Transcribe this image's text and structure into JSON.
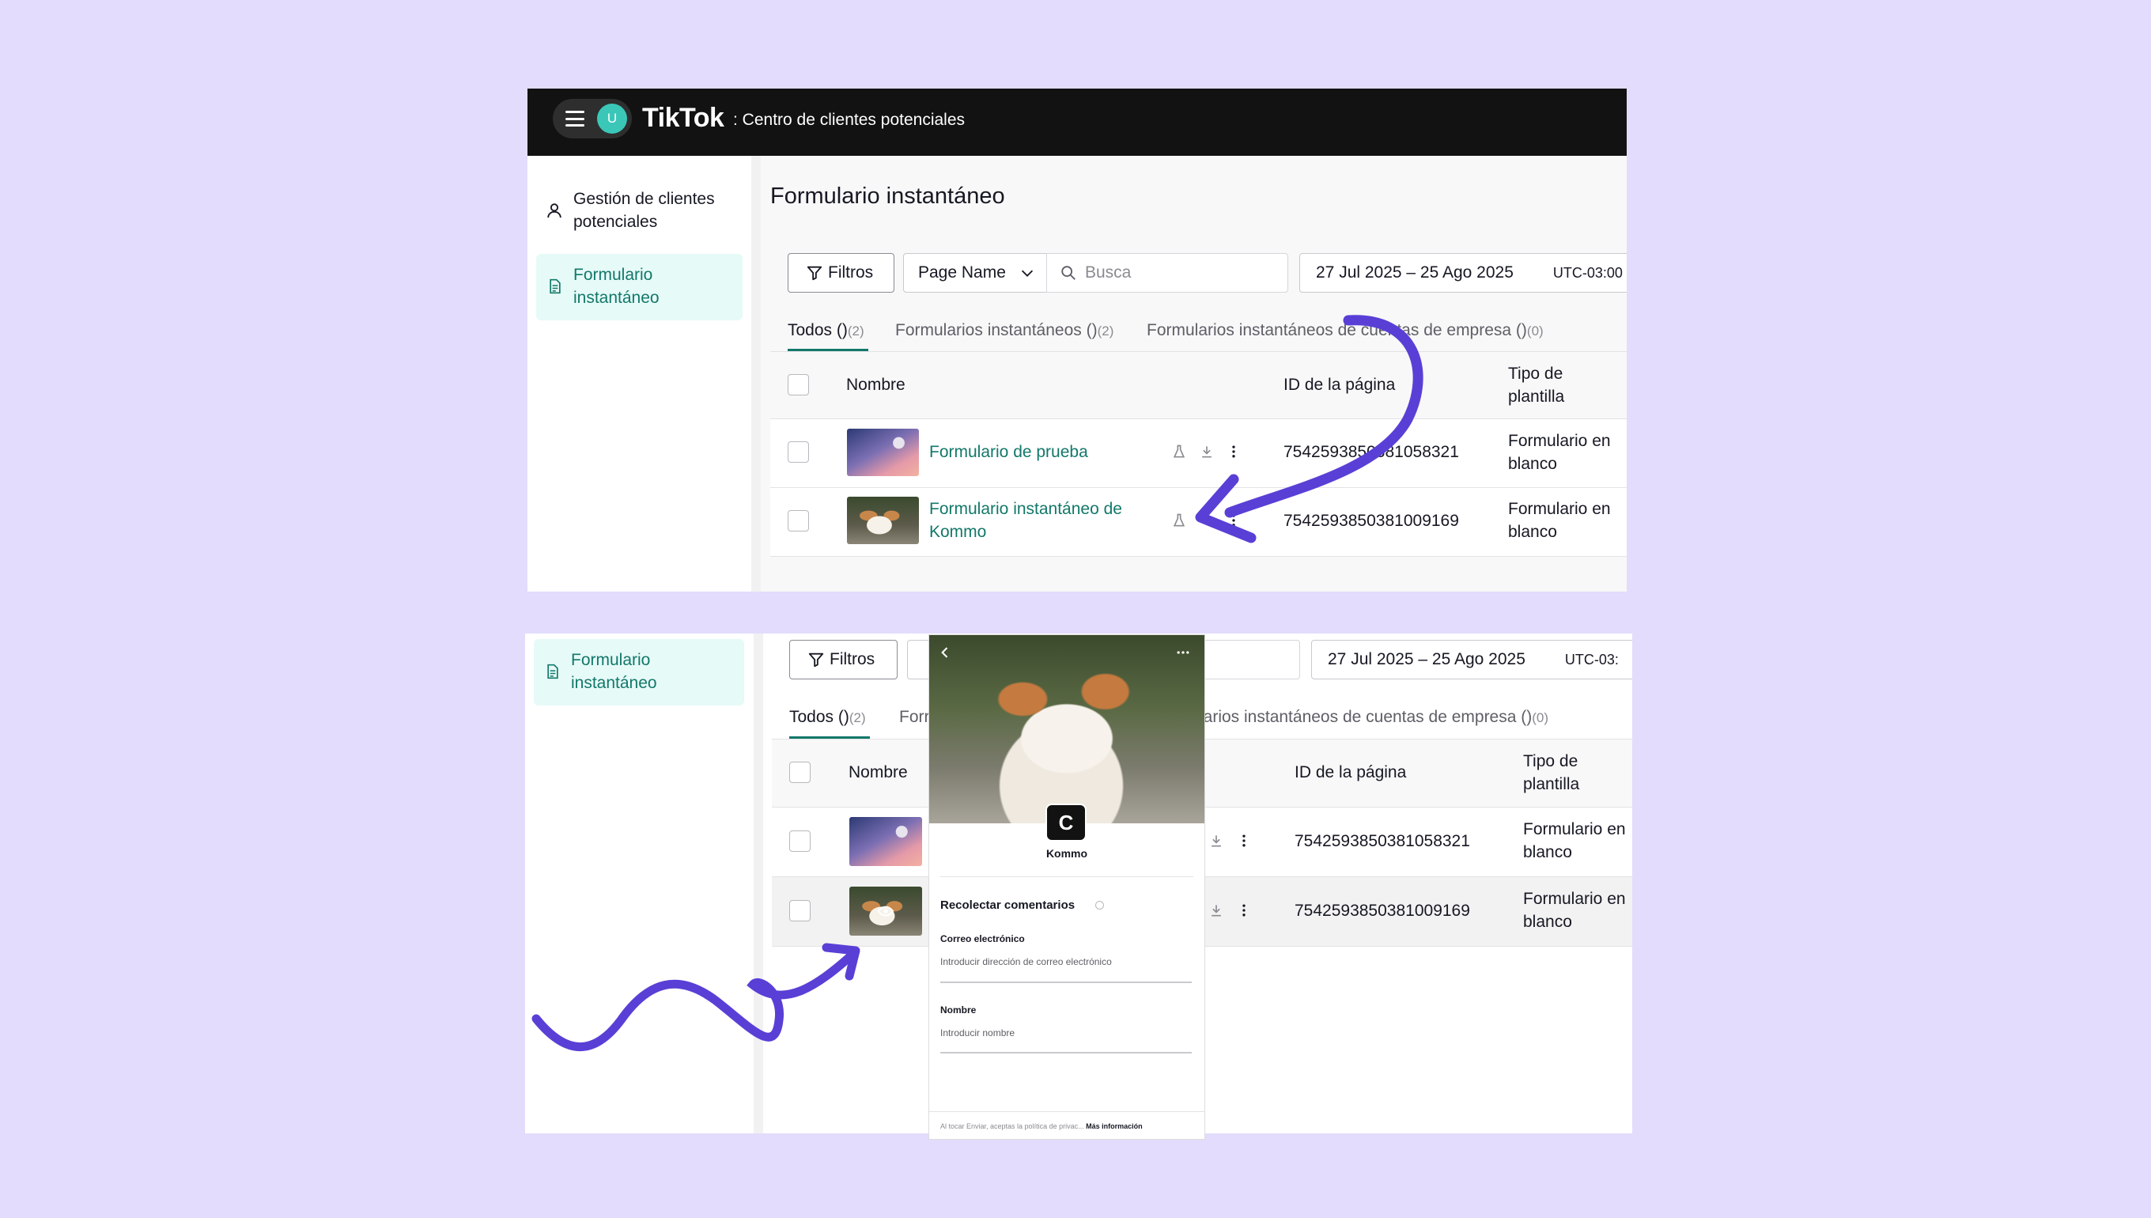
{
  "colors": {
    "background": "#e3dcfc",
    "accent": "#127869",
    "arrow": "#5a3fd6",
    "topbar": "#121212",
    "avatar": "#3bc7b8"
  },
  "header": {
    "avatar_initial": "U",
    "brand": "TikTok",
    "subtitle": ": Centro de clientes potenciales",
    "menu_icon": "hamburger-icon"
  },
  "sidebar": {
    "item_leads": "Gestión de clientes potenciales",
    "item_forms": "Formulario instantáneo",
    "icon_leads": "user-icon",
    "icon_forms": "document-icon"
  },
  "page": {
    "title": "Formulario instantáneo"
  },
  "toolbar": {
    "filters": "Filtros",
    "page_name": "Page Name",
    "search_placeholder": "Busca",
    "date_range": "27 Jul 2025 – 25 Ago 2025",
    "timezone_top": "UTC-03:00",
    "timezone_bottom": "UTC-03:"
  },
  "tabs": [
    {
      "label": "Todos ()",
      "count": "(2)"
    },
    {
      "label": "Formularios instantáneos ()",
      "count": "(2)"
    },
    {
      "label": "Formularios instantáneos de cuentas de empresa ()",
      "count": "(0)"
    }
  ],
  "tabs_bottom": {
    "partial_second": "Forr",
    "partial_third": "larios instantáneos de cuentas de empresa ()"
  },
  "table": {
    "headers": {
      "name": "Nombre",
      "page_id": "ID de la página",
      "template_line1": "Tipo de",
      "template_line2": "plantilla"
    },
    "rows": [
      {
        "name": "Formulario de prueba",
        "page_id": "7542593850381058321",
        "template_line1": "Formulario en",
        "template_line2": "blanco"
      },
      {
        "name_line1": "Formulario instantáneo de",
        "name_line2": "Kommo",
        "page_id": "7542593850381009169",
        "template_line1": "Formulario en",
        "template_line2": "blanco"
      }
    ]
  },
  "preview": {
    "brand": "Kommo",
    "logo_letter": "C",
    "section_title": "Recolectar comentarios",
    "email_label": "Correo electrónico",
    "email_placeholder": "Introducir dirección de correo electrónico",
    "name_label": "Nombre",
    "name_placeholder": "Introducir nombre",
    "footer_text": "Al tocar Enviar, aceptas la política de privac...",
    "footer_link": "Más información",
    "back_icon": "chevron-left-icon",
    "more_icon": "more-horizontal-icon"
  }
}
